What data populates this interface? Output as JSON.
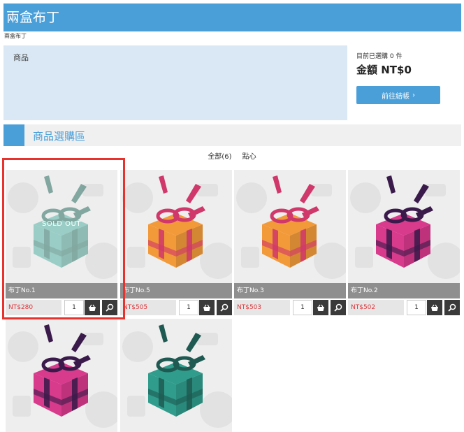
{
  "header": {
    "title": "兩盒布丁",
    "subname": "兩盒布丁"
  },
  "category_panel": {
    "label": "商品"
  },
  "cart": {
    "count_label": "目前已選購",
    "count_value": "0",
    "count_unit": "件",
    "total_label": "金額",
    "total_value": "NT$0",
    "checkout_label": "前往結帳"
  },
  "section": {
    "title": "商品選購區"
  },
  "filters": [
    "全部(6)",
    "點心"
  ],
  "products": [
    {
      "name": "布丁No.1",
      "price": "NT$280",
      "qty": "1",
      "sold_out": true,
      "sold_out_label": "SOLD OUT",
      "color": "#7fc3b8",
      "ribbon": "#5e8f86"
    },
    {
      "name": "布丁No.5",
      "price": "NT$505",
      "qty": "1",
      "sold_out": false,
      "color": "#f29a3a",
      "ribbon": "#d0376a"
    },
    {
      "name": "布丁No.3",
      "price": "NT$503",
      "qty": "1",
      "sold_out": false,
      "color": "#f29a3a",
      "ribbon": "#d0376a"
    },
    {
      "name": "布丁No.2",
      "price": "NT$502",
      "qty": "1",
      "sold_out": false,
      "color": "#d83a8c",
      "ribbon": "#3a1a4a"
    },
    {
      "name": "",
      "price": "",
      "qty": "",
      "sold_out": false,
      "color": "#d83a8c",
      "ribbon": "#3a1a4a"
    },
    {
      "name": "",
      "price": "",
      "qty": "",
      "sold_out": false,
      "color": "#2f9c8c",
      "ribbon": "#1e5a52"
    }
  ],
  "colors": {
    "accent": "#4a9fd9",
    "price": "#e0353a",
    "highlight": "#e8322e"
  }
}
